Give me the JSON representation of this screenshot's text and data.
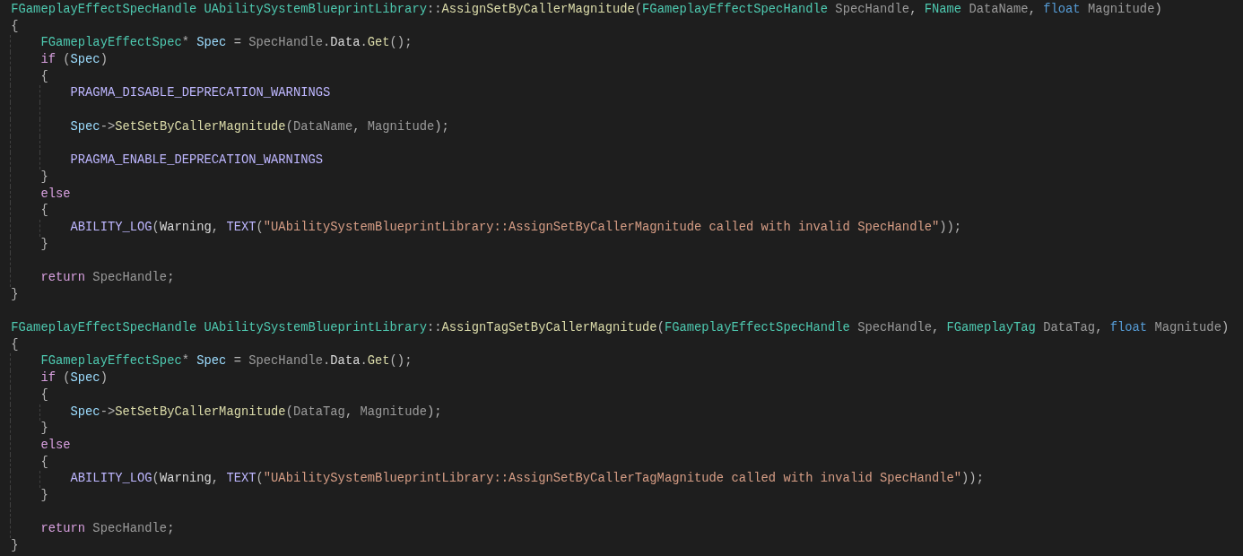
{
  "editor": {
    "lines": [
      {
        "kind": "code",
        "tokens": [
          {
            "text": "FGameplayEffectSpecHandle ",
            "kind": "type"
          },
          {
            "text": "UAbilitySystemBlueprintLibrary",
            "kind": "type"
          },
          {
            "text": "::",
            "kind": "punct"
          },
          {
            "text": "AssignSetByCallerMagnitude",
            "kind": "func"
          },
          {
            "text": "(",
            "kind": "punct"
          },
          {
            "text": "FGameplayEffectSpecHandle ",
            "kind": "type"
          },
          {
            "text": "SpecHandle",
            "kind": "param"
          },
          {
            "text": ", ",
            "kind": "punct"
          },
          {
            "text": "FName ",
            "kind": "type"
          },
          {
            "text": "DataName",
            "kind": "param"
          },
          {
            "text": ", ",
            "kind": "punct"
          },
          {
            "text": "float ",
            "kind": "keyword"
          },
          {
            "text": "Magnitude",
            "kind": "param"
          },
          {
            "text": ")",
            "kind": "punct"
          }
        ]
      },
      {
        "kind": "code",
        "tokens": [
          {
            "text": "{",
            "kind": "punct"
          }
        ]
      },
      {
        "kind": "code",
        "tokens": [
          {
            "text": "    FGameplayEffectSpec",
            "kind": "type"
          },
          {
            "text": "* ",
            "kind": "punct"
          },
          {
            "text": "Spec",
            "kind": "local"
          },
          {
            "text": " = ",
            "kind": "punct"
          },
          {
            "text": "SpecHandle",
            "kind": "param"
          },
          {
            "text": ".",
            "kind": "punct"
          },
          {
            "text": "Data",
            "kind": "member"
          },
          {
            "text": ".",
            "kind": "punct"
          },
          {
            "text": "Get",
            "kind": "func"
          },
          {
            "text": "();",
            "kind": "punct"
          }
        ]
      },
      {
        "kind": "code",
        "tokens": [
          {
            "text": "    if",
            "kind": "control"
          },
          {
            "text": " (",
            "kind": "punct"
          },
          {
            "text": "Spec",
            "kind": "local"
          },
          {
            "text": ")",
            "kind": "punct"
          }
        ]
      },
      {
        "kind": "code",
        "tokens": [
          {
            "text": "    {",
            "kind": "punct"
          }
        ]
      },
      {
        "kind": "code",
        "tokens": [
          {
            "text": "        PRAGMA_DISABLE_DEPRECATION_WARNINGS",
            "kind": "macro"
          }
        ]
      },
      {
        "kind": "blank"
      },
      {
        "kind": "code",
        "tokens": [
          {
            "text": "        Spec",
            "kind": "local"
          },
          {
            "text": "->",
            "kind": "punct"
          },
          {
            "text": "SetSetByCallerMagnitude",
            "kind": "func"
          },
          {
            "text": "(",
            "kind": "punct"
          },
          {
            "text": "DataName",
            "kind": "param"
          },
          {
            "text": ", ",
            "kind": "punct"
          },
          {
            "text": "Magnitude",
            "kind": "param"
          },
          {
            "text": ");",
            "kind": "punct"
          }
        ]
      },
      {
        "kind": "blank"
      },
      {
        "kind": "code",
        "tokens": [
          {
            "text": "        PRAGMA_ENABLE_DEPRECATION_WARNINGS",
            "kind": "macro"
          }
        ]
      },
      {
        "kind": "code",
        "tokens": [
          {
            "text": "    }",
            "kind": "punct"
          }
        ]
      },
      {
        "kind": "code",
        "tokens": [
          {
            "text": "    else",
            "kind": "control"
          }
        ]
      },
      {
        "kind": "code",
        "tokens": [
          {
            "text": "    {",
            "kind": "punct"
          }
        ]
      },
      {
        "kind": "code",
        "tokens": [
          {
            "text": "        ABILITY_LOG",
            "kind": "macro"
          },
          {
            "text": "(",
            "kind": "punct"
          },
          {
            "text": "Warning",
            "kind": "member"
          },
          {
            "text": ", ",
            "kind": "punct"
          },
          {
            "text": "TEXT",
            "kind": "macro"
          },
          {
            "text": "(",
            "kind": "punct"
          },
          {
            "text": "\"UAbilitySystemBlueprintLibrary::AssignSetByCallerMagnitude called with invalid SpecHandle\"",
            "kind": "string"
          },
          {
            "text": "));",
            "kind": "punct"
          }
        ]
      },
      {
        "kind": "code",
        "tokens": [
          {
            "text": "    }",
            "kind": "punct"
          }
        ]
      },
      {
        "kind": "blank"
      },
      {
        "kind": "code",
        "tokens": [
          {
            "text": "    return ",
            "kind": "control"
          },
          {
            "text": "SpecHandle",
            "kind": "param"
          },
          {
            "text": ";",
            "kind": "punct"
          }
        ]
      },
      {
        "kind": "code",
        "tokens": [
          {
            "text": "}",
            "kind": "punct"
          }
        ]
      },
      {
        "kind": "blank"
      },
      {
        "kind": "code",
        "tokens": [
          {
            "text": "FGameplayEffectSpecHandle ",
            "kind": "type"
          },
          {
            "text": "UAbilitySystemBlueprintLibrary",
            "kind": "type"
          },
          {
            "text": "::",
            "kind": "punct"
          },
          {
            "text": "AssignTagSetByCallerMagnitude",
            "kind": "func"
          },
          {
            "text": "(",
            "kind": "punct"
          },
          {
            "text": "FGameplayEffectSpecHandle ",
            "kind": "type"
          },
          {
            "text": "SpecHandle",
            "kind": "param"
          },
          {
            "text": ", ",
            "kind": "punct"
          },
          {
            "text": "FGameplayTag ",
            "kind": "type"
          },
          {
            "text": "DataTag",
            "kind": "param"
          },
          {
            "text": ", ",
            "kind": "punct"
          },
          {
            "text": "float ",
            "kind": "keyword"
          },
          {
            "text": "Magnitude",
            "kind": "param"
          },
          {
            "text": ")",
            "kind": "punct"
          }
        ]
      },
      {
        "kind": "code",
        "tokens": [
          {
            "text": "{",
            "kind": "punct"
          }
        ]
      },
      {
        "kind": "code",
        "tokens": [
          {
            "text": "    FGameplayEffectSpec",
            "kind": "type"
          },
          {
            "text": "* ",
            "kind": "punct"
          },
          {
            "text": "Spec",
            "kind": "local"
          },
          {
            "text": " = ",
            "kind": "punct"
          },
          {
            "text": "SpecHandle",
            "kind": "param"
          },
          {
            "text": ".",
            "kind": "punct"
          },
          {
            "text": "Data",
            "kind": "member"
          },
          {
            "text": ".",
            "kind": "punct"
          },
          {
            "text": "Get",
            "kind": "func"
          },
          {
            "text": "();",
            "kind": "punct"
          }
        ]
      },
      {
        "kind": "code",
        "tokens": [
          {
            "text": "    if",
            "kind": "control"
          },
          {
            "text": " (",
            "kind": "punct"
          },
          {
            "text": "Spec",
            "kind": "local"
          },
          {
            "text": ")",
            "kind": "punct"
          }
        ]
      },
      {
        "kind": "code",
        "tokens": [
          {
            "text": "    {",
            "kind": "punct"
          }
        ]
      },
      {
        "kind": "code",
        "tokens": [
          {
            "text": "        Spec",
            "kind": "local"
          },
          {
            "text": "->",
            "kind": "punct"
          },
          {
            "text": "SetSetByCallerMagnitude",
            "kind": "func"
          },
          {
            "text": "(",
            "kind": "punct"
          },
          {
            "text": "DataTag",
            "kind": "param"
          },
          {
            "text": ", ",
            "kind": "punct"
          },
          {
            "text": "Magnitude",
            "kind": "param"
          },
          {
            "text": ");",
            "kind": "punct"
          }
        ]
      },
      {
        "kind": "code",
        "tokens": [
          {
            "text": "    }",
            "kind": "punct"
          }
        ]
      },
      {
        "kind": "code",
        "tokens": [
          {
            "text": "    else",
            "kind": "control"
          }
        ]
      },
      {
        "kind": "code",
        "tokens": [
          {
            "text": "    {",
            "kind": "punct"
          }
        ]
      },
      {
        "kind": "code",
        "tokens": [
          {
            "text": "        ABILITY_LOG",
            "kind": "macro"
          },
          {
            "text": "(",
            "kind": "punct"
          },
          {
            "text": "Warning",
            "kind": "member"
          },
          {
            "text": ", ",
            "kind": "punct"
          },
          {
            "text": "TEXT",
            "kind": "macro"
          },
          {
            "text": "(",
            "kind": "punct"
          },
          {
            "text": "\"UAbilitySystemBlueprintLibrary::AssignSetByCallerTagMagnitude called with invalid SpecHandle\"",
            "kind": "string"
          },
          {
            "text": "));",
            "kind": "punct"
          }
        ]
      },
      {
        "kind": "code",
        "tokens": [
          {
            "text": "    }",
            "kind": "punct"
          }
        ]
      },
      {
        "kind": "blank"
      },
      {
        "kind": "code",
        "tokens": [
          {
            "text": "    return ",
            "kind": "control"
          },
          {
            "text": "SpecHandle",
            "kind": "param"
          },
          {
            "text": ";",
            "kind": "punct"
          }
        ]
      },
      {
        "kind": "code",
        "tokens": [
          {
            "text": "}",
            "kind": "punct"
          }
        ]
      }
    ]
  }
}
